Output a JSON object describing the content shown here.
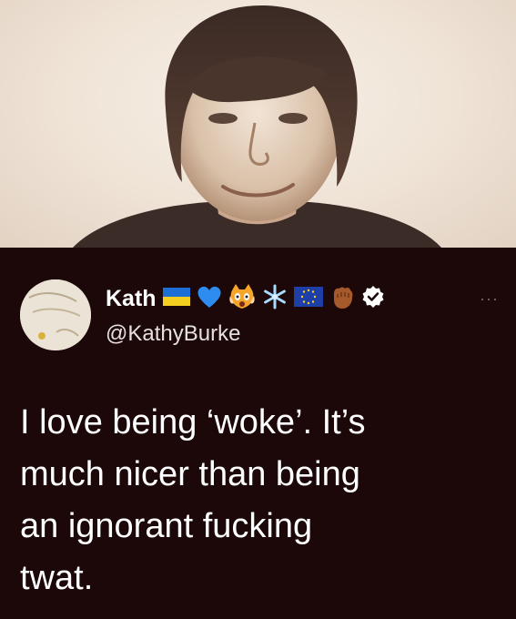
{
  "tweet": {
    "display_name": "Kath",
    "handle": "@KathyBurke",
    "more_label": "···",
    "text_lines": [
      "I love being ‘woke’. It’s",
      "much nicer than being",
      "an ignorant fucking",
      "twat."
    ],
    "name_emojis": [
      "ukraine-flag-icon",
      "blue-heart-icon",
      "shocked-cat-icon",
      "snowflake-icon",
      "eu-flag-icon",
      "raised-fist-icon",
      "verified-badge-icon"
    ]
  },
  "colors": {
    "tweet_background": "#1c0709",
    "text": "#ffffff",
    "handle": "#e6e1e1",
    "photo_background": "#efe3d6"
  }
}
